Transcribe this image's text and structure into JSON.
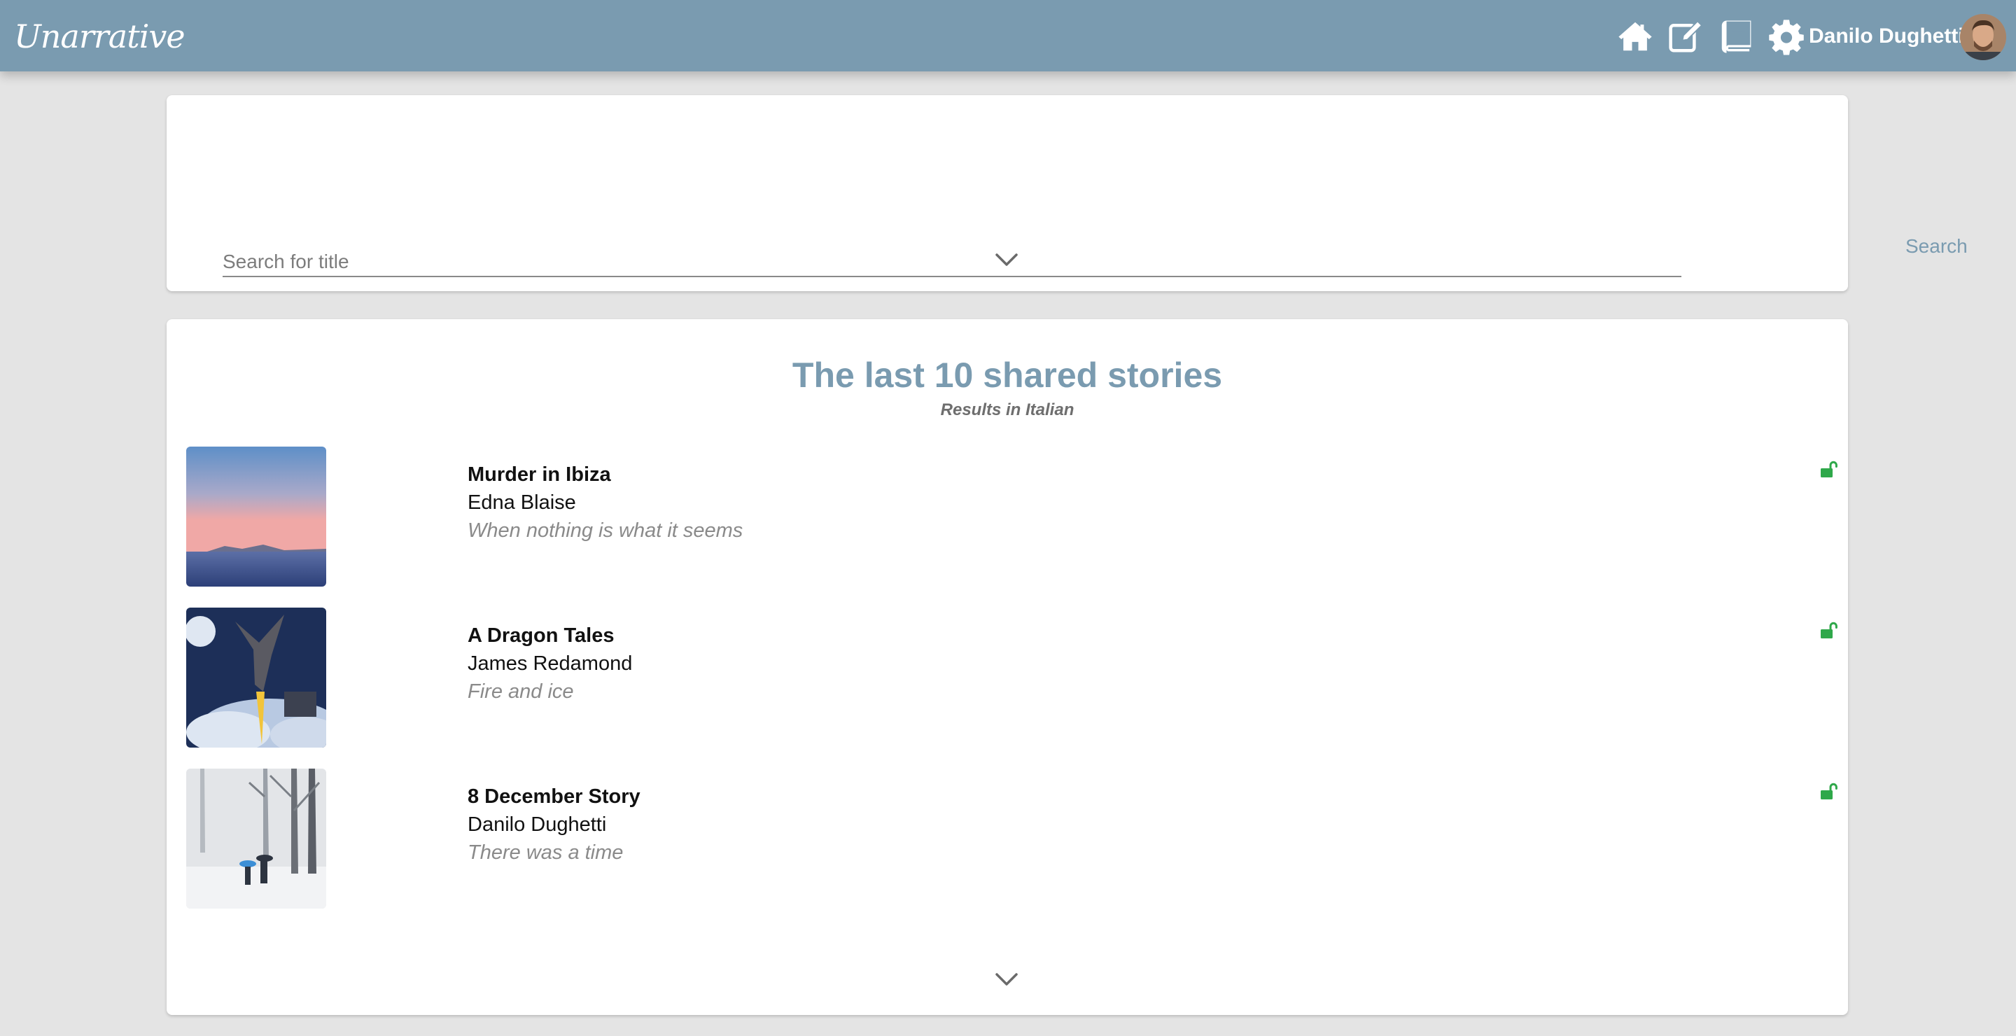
{
  "app": {
    "logo_text": "Unarrative"
  },
  "nav": {
    "icons": [
      "home-icon",
      "edit-icon",
      "book-icon",
      "gear-icon"
    ],
    "user_name": "Danilo Dughetti"
  },
  "search": {
    "placeholder": "Search for title",
    "value": "",
    "button_label": "Search"
  },
  "stories_section": {
    "title": "The last 10 shared stories",
    "subtitle": "Results in Italian",
    "items": [
      {
        "title": "Murder in Ibiza",
        "author": "Edna Blaise",
        "tagline": "When nothing is what it seems",
        "status_icon": "unlock-icon"
      },
      {
        "title": "A Dragon Tales",
        "author": "James Redamond",
        "tagline": "Fire and ice",
        "status_icon": "unlock-icon"
      },
      {
        "title": "8 December Story",
        "author": "Danilo Dughetti",
        "tagline": "There was a time",
        "status_icon": "unlock-icon"
      }
    ]
  },
  "colors": {
    "header": "#7a9bb0",
    "accent": "#7a9bb0",
    "unlock": "#2fa84a",
    "background": "#e4e4e4"
  }
}
